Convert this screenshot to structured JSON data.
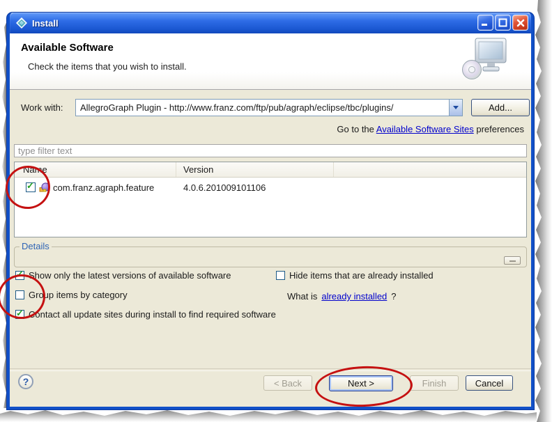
{
  "window": {
    "title": "Install"
  },
  "header": {
    "title": "Available Software",
    "subtitle": "Check the items that you wish to install."
  },
  "work_with": {
    "label": "Work with:",
    "value": "AllegroGraph Plugin - http://www.franz.com/ftp/pub/agraph/eclipse/tbc/plugins/",
    "add_button": "Add..."
  },
  "sites_line": {
    "prefix": "Go to the ",
    "link": "Available Software Sites",
    "suffix": " preferences"
  },
  "filter": {
    "placeholder": "type filter text"
  },
  "table": {
    "columns": [
      "Name",
      "Version"
    ],
    "rows": [
      {
        "name": "com.franz.agraph.feature",
        "version": "4.0.6.201009101106",
        "checked": true
      }
    ]
  },
  "details": {
    "label": "Details"
  },
  "options": {
    "show_latest": {
      "label": "Show only the latest versions of available software",
      "checked": true
    },
    "group_category": {
      "label": "Group items by category",
      "checked": false
    },
    "contact_sites": {
      "label": "Contact all update sites during install to find required software",
      "checked": true
    },
    "hide_installed": {
      "label": "Hide items that are already installed",
      "checked": false
    },
    "what_is": {
      "prefix": "What is ",
      "link": "already installed",
      "suffix": "?"
    }
  },
  "buttons": {
    "help": "?",
    "back": "< Back",
    "next": "Next >",
    "finish": "Finish",
    "cancel": "Cancel"
  },
  "icons": {
    "check": "✓"
  },
  "annotations": {
    "color": "#c51111",
    "targets": [
      "feature-row-checkbox",
      "group-items-checkbox",
      "next-button"
    ]
  },
  "colors": {
    "titlebar_blue": "#1b58d2",
    "content_bg": "#ece9d8",
    "link_blue": "#0000cc",
    "check_green": "#23a123",
    "annotation_red": "#c51111"
  }
}
